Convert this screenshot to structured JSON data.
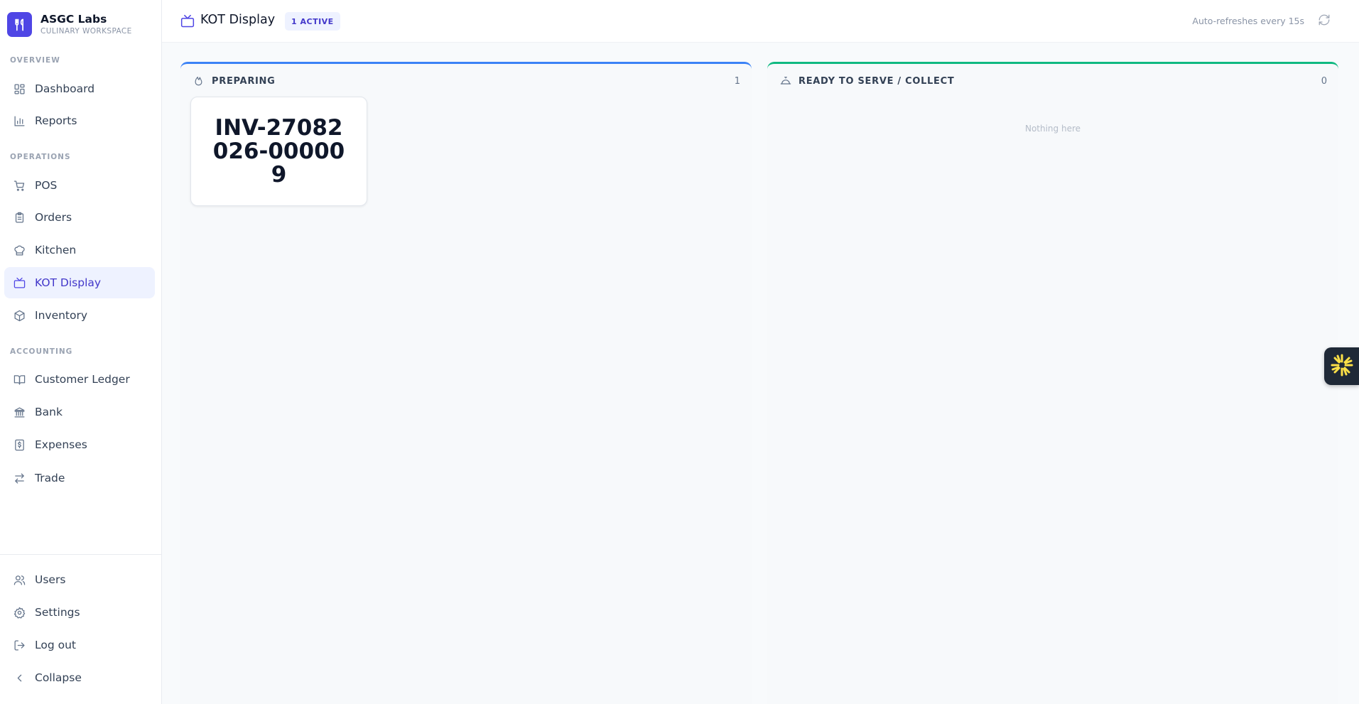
{
  "brand": {
    "name": "ASGC Labs",
    "subtitle": "CULINARY WORKSPACE",
    "color": "#4f46e5"
  },
  "sidebar": {
    "sections": {
      "overview": "OVERVIEW",
      "operations": "OPERATIONS",
      "accounting": "ACCOUNTING"
    },
    "items": {
      "dashboard": "Dashboard",
      "reports": "Reports",
      "pos": "POS",
      "orders": "Orders",
      "kitchen": "Kitchen",
      "kot_display": "KOT Display",
      "inventory": "Inventory",
      "customer_ledger": "Customer Ledger",
      "bank": "Bank",
      "expenses": "Expenses",
      "trade": "Trade"
    },
    "footer": {
      "users": "Users",
      "settings": "Settings",
      "logout": "Log out",
      "collapse": "Collapse"
    },
    "active_item": "kot_display"
  },
  "header": {
    "title": "KOT Display",
    "badge": "1 ACTIVE",
    "refresh_text": "Auto-refreshes every 15s"
  },
  "columns": {
    "preparing": {
      "title": "PREPARING",
      "count": "1",
      "accent": "#3b82f6",
      "cards": [
        {
          "invoice": "INV-27082026-000009"
        }
      ]
    },
    "ready": {
      "title": "READY TO SERVE / COLLECT",
      "count": "0",
      "accent": "#10b981",
      "empty_text": "Nothing here"
    }
  },
  "icons": {
    "brand": "utensils-icon",
    "widget": "asterisk-burst-icon"
  }
}
